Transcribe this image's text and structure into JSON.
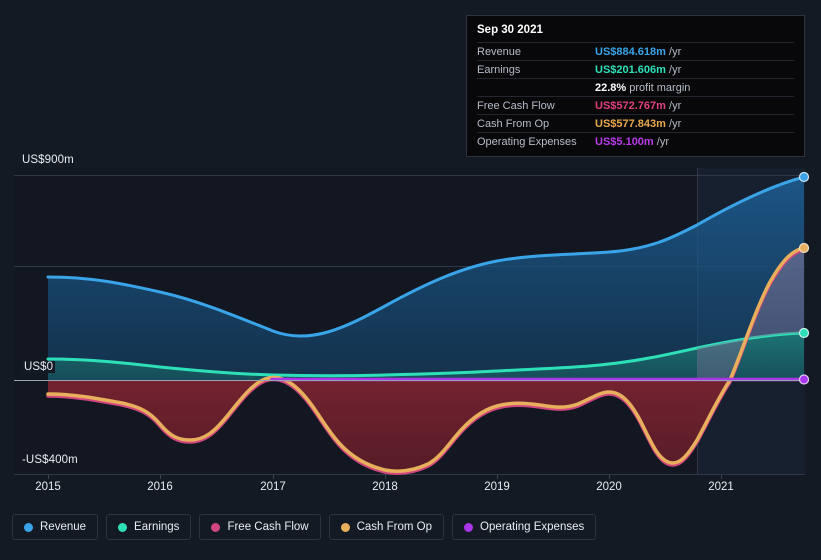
{
  "tooltip": {
    "title": "Sep 30 2021",
    "rows": [
      {
        "key": "Revenue",
        "value": "US$884.618m",
        "suffix": "/yr",
        "color": "#3aa4e8"
      },
      {
        "key": "Earnings",
        "value": "US$201.606m",
        "suffix": "/yr",
        "color": "#2ee0b8"
      },
      {
        "key": "",
        "value": "22.8%",
        "suffix": "profit margin",
        "color": "#ffffff"
      },
      {
        "key": "Free Cash Flow",
        "value": "US$572.767m",
        "suffix": "/yr",
        "color": "#e0417e"
      },
      {
        "key": "Cash From Op",
        "value": "US$577.843m",
        "suffix": "/yr",
        "color": "#e8a94e"
      },
      {
        "key": "Operating Expenses",
        "value": "US$5.100m",
        "suffix": "/yr",
        "color": "#b83ce8"
      }
    ]
  },
  "legend": {
    "items": [
      {
        "label": "Revenue",
        "color": "#3aa4e8",
        "name": "legend-revenue"
      },
      {
        "label": "Earnings",
        "color": "#2ee0b8",
        "name": "legend-earnings"
      },
      {
        "label": "Free Cash Flow",
        "color": "#d1467e",
        "name": "legend-free-cash-flow"
      },
      {
        "label": "Cash From Op",
        "color": "#e8b05c",
        "name": "legend-cash-from-op"
      },
      {
        "label": "Operating Expenses",
        "color": "#a936e8",
        "name": "legend-operating-expenses"
      }
    ]
  },
  "chart_data": {
    "type": "area",
    "title": "",
    "xlabel": "",
    "ylabel": "",
    "ylim": [
      -400,
      900
    ],
    "yticks": [
      900,
      0,
      -400
    ],
    "ytick_labels": [
      "US$900m",
      "US$0",
      "-US$400m"
    ],
    "grid": true,
    "legend_position": "bottom",
    "x": [
      2015,
      2016,
      2017,
      2018,
      2019,
      2020,
      2021
    ],
    "xtick_labels": [
      "2015",
      "2016",
      "2017",
      "2018",
      "2019",
      "2020",
      "2021"
    ],
    "xlim": [
      2014.75,
      2021.75
    ],
    "highlight_band": {
      "from": 2020.8,
      "to": 2021.75,
      "label": ""
    },
    "series": [
      {
        "name": "Revenue",
        "color": "#3aa4e8",
        "fill": true,
        "values": [
          420,
          380,
          310,
          330,
          470,
          500,
          620,
          885
        ],
        "x": [
          2015.0,
          2015.8,
          2016.8,
          2017.6,
          2018.6,
          2019.6,
          2020.6,
          2021.75
        ],
        "end_value": 884.618
      },
      {
        "name": "Earnings",
        "color": "#2ee0b8",
        "fill": true,
        "values": [
          40,
          25,
          15,
          10,
          12,
          25,
          70,
          202
        ],
        "x": [
          2015.0,
          2015.8,
          2016.8,
          2017.6,
          2018.6,
          2019.6,
          2020.6,
          2021.75
        ],
        "end_value": 201.606
      },
      {
        "name": "Free Cash Flow",
        "color": "#d1467e",
        "fill": true,
        "values": [
          -45,
          -95,
          -10,
          -145,
          -370,
          -225,
          -215,
          -320,
          573
        ],
        "x": [
          2015.0,
          2015.9,
          2016.9,
          2017.6,
          2018.2,
          2018.9,
          2019.6,
          2020.5,
          2021.75
        ],
        "end_value": 572.767
      },
      {
        "name": "Cash From Op",
        "color": "#e8b05c",
        "fill": true,
        "values": [
          -40,
          -90,
          10,
          -140,
          -365,
          -220,
          -210,
          -315,
          578
        ],
        "x": [
          2015.0,
          2015.9,
          2016.9,
          2017.6,
          2018.2,
          2018.9,
          2019.6,
          2020.5,
          2021.75
        ],
        "end_value": 577.843
      },
      {
        "name": "Operating Expenses",
        "color": "#a936e8",
        "fill": false,
        "values": [
          4,
          5,
          5,
          5,
          5.1
        ],
        "x": [
          2017.0,
          2018.5,
          2019.5,
          2020.5,
          2021.75
        ],
        "end_value": 5.1
      }
    ]
  }
}
